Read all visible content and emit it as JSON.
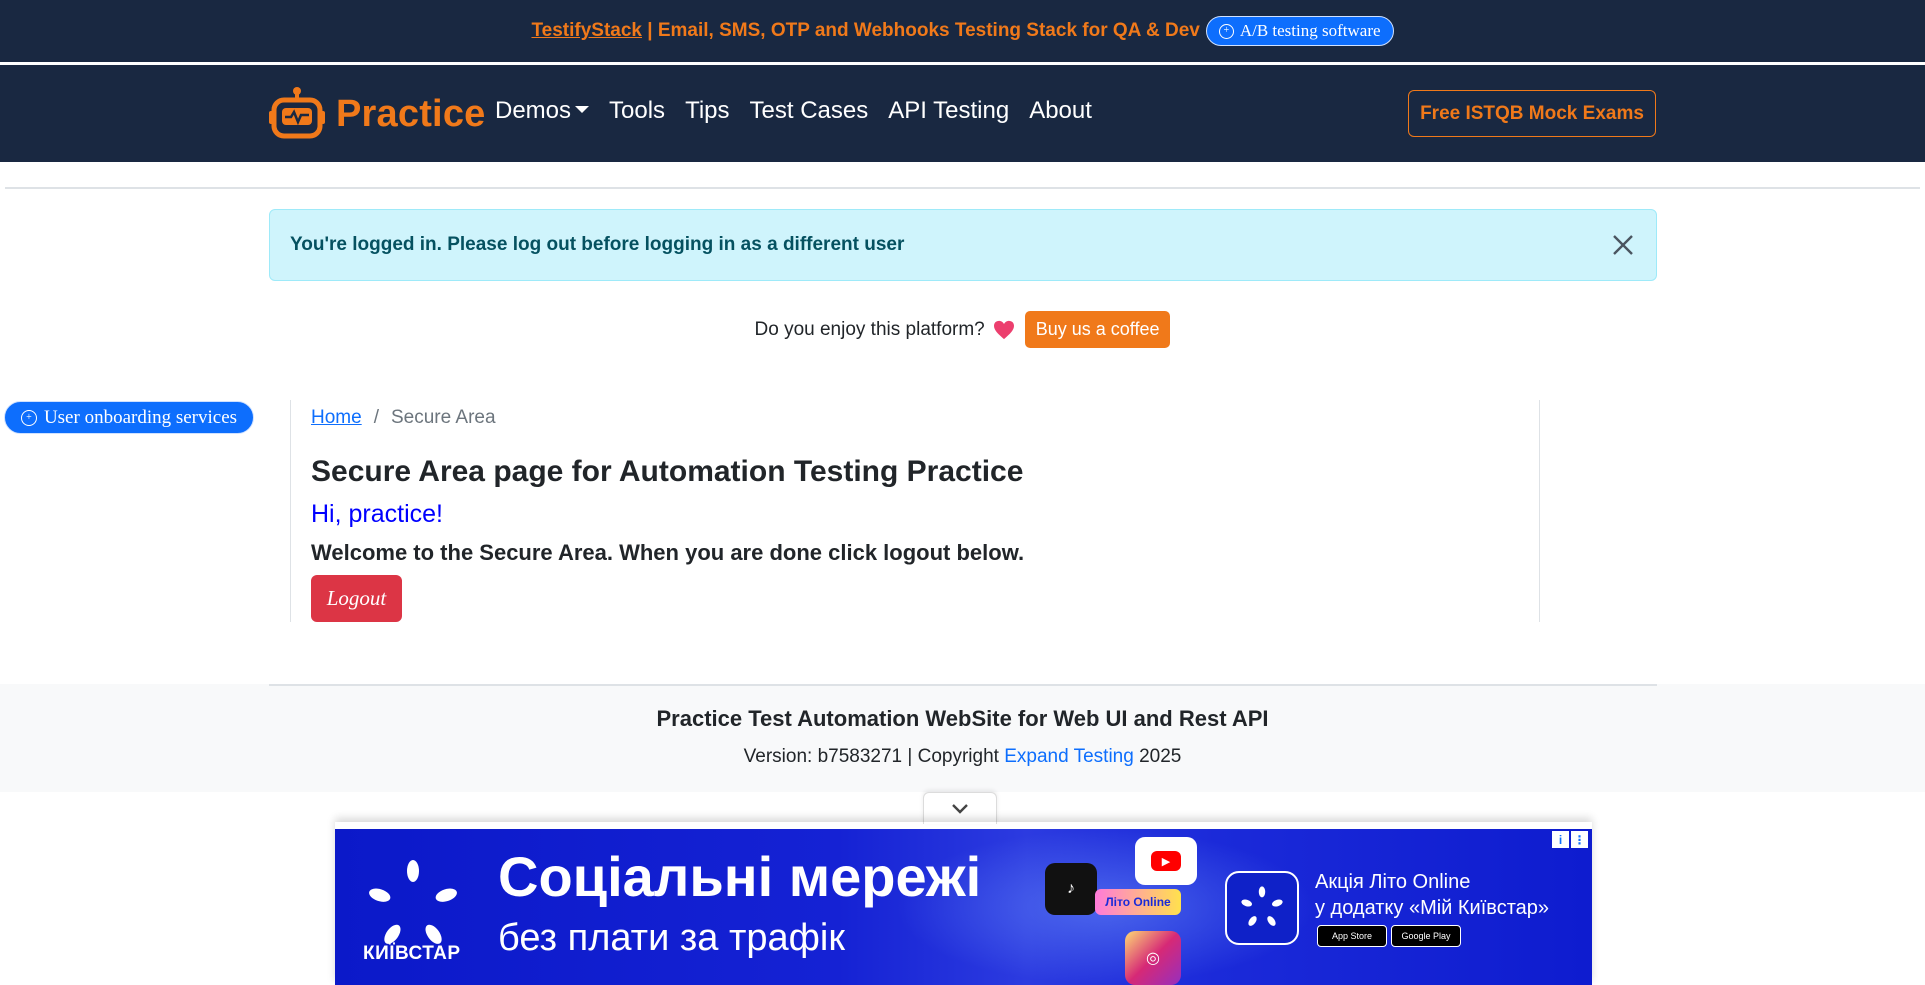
{
  "promo": {
    "brand_link": "TestifyStack",
    "text": " | Email, SMS, OTP and Webhooks Testing Stack for QA & Dev",
    "pill_label": "A/B testing software"
  },
  "nav": {
    "brand": "Practice",
    "links": [
      "Demos",
      "Tools",
      "Tips",
      "Test Cases",
      "API Testing",
      "About"
    ],
    "cta": "Free ISTQB Mock Exams"
  },
  "alert": {
    "message": "You're logged in. Please log out before logging in as a different user"
  },
  "coffee": {
    "question": "Do you enjoy this platform?",
    "button": "Buy us a coffee"
  },
  "side_pill": {
    "label": "User onboarding services"
  },
  "breadcrumb": {
    "home": "Home",
    "separator": "/",
    "current": "Secure Area"
  },
  "main": {
    "title": "Secure Area page for Automation Testing Practice",
    "greeting": "Hi, practice!",
    "welcome": "Welcome to the Secure Area. When you are done click logout below.",
    "logout": "Logout"
  },
  "footer": {
    "title": "Practice Test Automation WebSite for Web UI and Rest API",
    "version_prefix": "Version: b7583271 | Copyright ",
    "company": "Expand Testing",
    "year": " 2025"
  },
  "ad": {
    "brand": "КИЇВСТАР",
    "headline": "Соціальні мережі",
    "subline": "без плати за трафік",
    "app_label": "Літо Online",
    "promo_line1": "Акція Літо Online",
    "promo_line2": "у додатку «Мій Київстар»",
    "app_store": "App Store",
    "google_play": "Google Play"
  },
  "colors": {
    "navy": "#192841",
    "orange": "#f0791a",
    "primary": "#0d6efd",
    "danger": "#dc3545",
    "alert_bg": "#cff4fc"
  },
  "icons": [
    "robot-logo-icon",
    "caret-down-icon",
    "close-icon",
    "heart-icon",
    "plus-circle-icon",
    "chevron-down-icon",
    "info-icon",
    "more-icon"
  ]
}
